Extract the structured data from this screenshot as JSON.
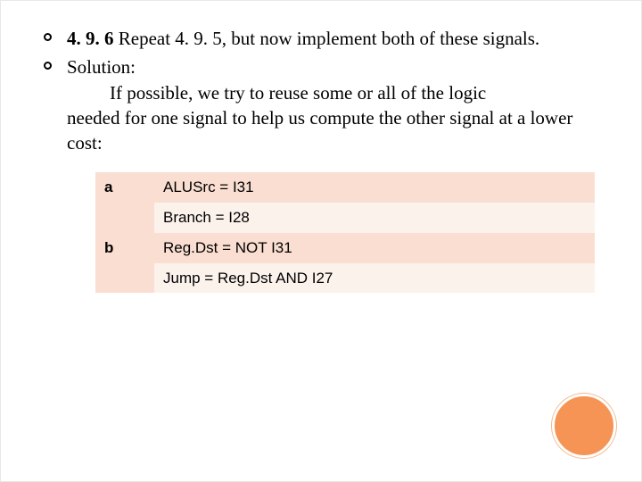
{
  "bullets": [
    {
      "lead_bold": "4. 9. 6 ",
      "rest": "Repeat 4. 9. 5, but now implement both of these signals."
    },
    {
      "lead": "Solution:",
      "body_first": "If possible, we try to reuse some or all of the logic",
      "body_rest": "needed for one signal to help us compute the other signal at a lower cost:"
    }
  ],
  "table": {
    "rows": [
      {
        "key": "a",
        "line1": "ALUSrc = I31",
        "line2": "Branch = I28"
      },
      {
        "key": "b",
        "line1": "Reg.Dst = NOT I31",
        "line2": "Jump = Reg.Dst AND I27"
      }
    ]
  }
}
